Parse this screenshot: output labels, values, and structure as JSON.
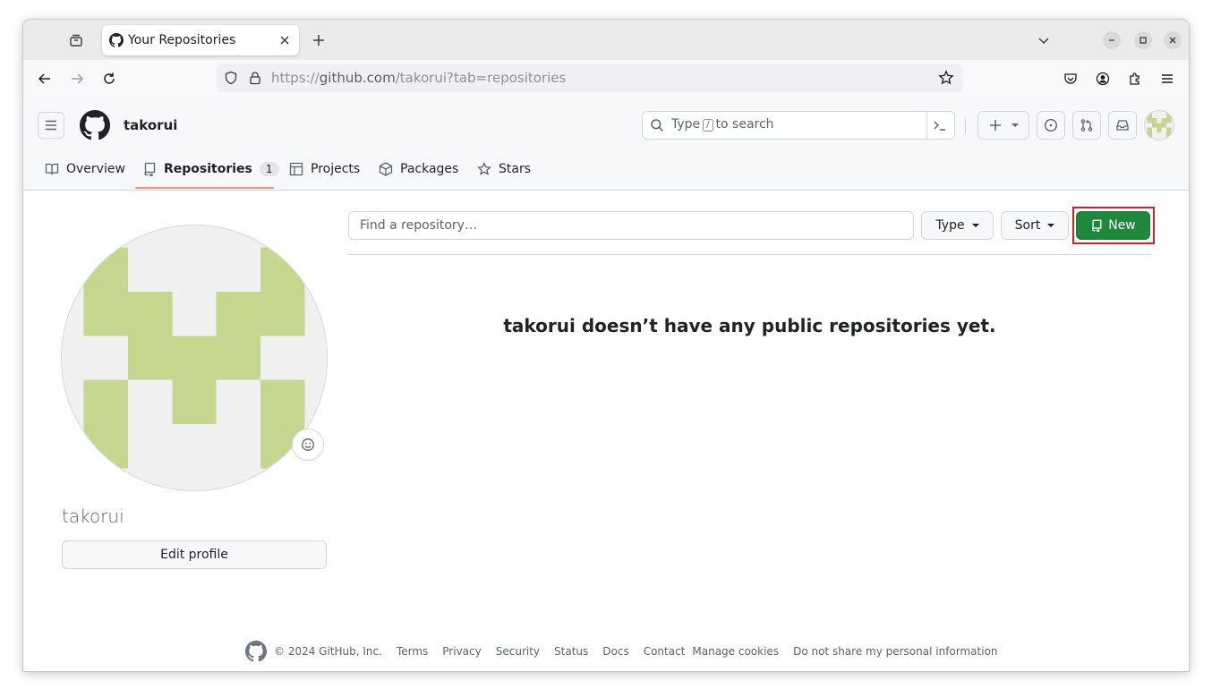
{
  "browser": {
    "tab_title": "Your Repositories",
    "url_prefix": "https://",
    "url_host": "github.com",
    "url_path": "/takorui?tab=repositories"
  },
  "header": {
    "username": "takorui",
    "search_prefix": "Type",
    "search_key": "/",
    "search_suffix": "to search"
  },
  "profile_tabs": [
    {
      "label": "Overview",
      "icon": "book-icon"
    },
    {
      "label": "Repositories",
      "icon": "repo-icon",
      "count": "1",
      "active": true
    },
    {
      "label": "Projects",
      "icon": "table-icon"
    },
    {
      "label": "Packages",
      "icon": "package-icon"
    },
    {
      "label": "Stars",
      "icon": "star-icon"
    }
  ],
  "profile": {
    "name": "takorui",
    "edit_label": "Edit profile",
    "avatar_color": "#c5d78f"
  },
  "repos": {
    "search_placeholder": "Find a repository…",
    "type_label": "Type",
    "sort_label": "Sort",
    "new_label": "New",
    "empty_message": "takorui doesn’t have any public repositories yet."
  },
  "footer": {
    "copyright": "© 2024 GitHub, Inc.",
    "links": [
      "Terms",
      "Privacy",
      "Security",
      "Status",
      "Docs",
      "Contact",
      "Manage cookies",
      "Do not share my personal information"
    ]
  },
  "colors": {
    "accent_green": "#1f883d",
    "highlight_red": "#d0202e",
    "tab_underline": "#fd8c73"
  }
}
